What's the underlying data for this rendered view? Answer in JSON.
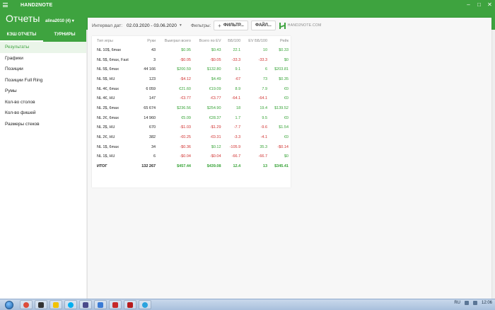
{
  "app": {
    "title": "HAND2NOTE"
  },
  "header": {
    "title": "Отчеты",
    "user": "alina2010 (4)"
  },
  "subtabs": [
    {
      "label": "КЭШ ОТЧЕТЫ",
      "active": true
    },
    {
      "label": "ТУРНИРЫ",
      "active": false
    }
  ],
  "sidebar": {
    "items": [
      {
        "label": "Результаты",
        "active": true
      },
      {
        "label": "Графики"
      },
      {
        "label": "Позиции"
      },
      {
        "label": "Позиции Full Ring"
      },
      {
        "label": "Румы"
      },
      {
        "label": "Кол-во столов"
      },
      {
        "label": "Кол-во фишей"
      },
      {
        "label": "Размеры стеков"
      }
    ]
  },
  "toolbar": {
    "interval_label": "Интервал дат:",
    "interval_value": "02.03.2020 - 03.06.2020",
    "filters_label": "Фильтры:",
    "filter_button": "ФИЛЬТР...",
    "file_button": "ФАЙЛ...",
    "logo_text": "HAND2NOTE.COM"
  },
  "table": {
    "headers": [
      "Тип игры",
      "Руки",
      "Выиграл всего",
      "Всего по EV",
      "ББ/100",
      "EV ББ/100",
      "Рейк"
    ],
    "rows": [
      [
        "NL 10$, 6max",
        "43",
        "$0.95",
        "$0.43",
        "22.1",
        "10",
        "$0.33"
      ],
      [
        "NL 5$, 6max, Fast",
        "3",
        "-$0.05",
        "-$0.05",
        "-33.3",
        "-33.3",
        "$0"
      ],
      [
        "NL 5$, 6max",
        "44 166",
        "$200.59",
        "$132.80",
        "9.1",
        "6",
        "$203.81"
      ],
      [
        "NL 5$, HU",
        "123",
        "-$4.12",
        "$4.49",
        "-67",
        "73",
        "$0.35"
      ],
      [
        "NL 4€, 6max",
        "6 059",
        "€21.60",
        "€19.09",
        "8.9",
        "7.9",
        "€0"
      ],
      [
        "NL 4€, HU",
        "147",
        "-€3.77",
        "-€3.77",
        "-64.1",
        "-64.1",
        "€0"
      ],
      [
        "NL 2$, 6max",
        "65 674",
        "$236.56",
        "$254.90",
        "18",
        "19.4",
        "$139.52"
      ],
      [
        "NL 2€, 6max",
        "14 960",
        "€5.09",
        "€28.37",
        "1.7",
        "9.5",
        "€0"
      ],
      [
        "NL 2$, HU",
        "670",
        "-$1.03",
        "-$1.29",
        "-7.7",
        "-9.6",
        "$1.54"
      ],
      [
        "NL 2€, HU",
        "382",
        "-€0.25",
        "-€0.31",
        "-3.3",
        "-4.1",
        "€0"
      ],
      [
        "NL 1$, 6max",
        "34",
        "-$0.36",
        "$0.12",
        "-105.9",
        "35.3",
        "-$0.14"
      ],
      [
        "NL 1$, HU",
        "6",
        "-$0.04",
        "-$0.04",
        "-66.7",
        "-66.7",
        "$0"
      ]
    ],
    "total": [
      "ИТОГ",
      "132 267",
      "$457.44",
      "$439.08",
      "12.4",
      "13",
      "$345.41"
    ]
  },
  "taskbar": {
    "lang": "RU",
    "time": "12:06",
    "icons": [
      "chrome-icon",
      "terminal-icon",
      "notes-icon",
      "skype-icon",
      "media-icon",
      "image-icon",
      "poker-icon",
      "cards-icon",
      "telegram-icon"
    ]
  },
  "colors": {
    "brand": "#3ea33f",
    "positive": "#36a336",
    "negative": "#d0302f"
  }
}
